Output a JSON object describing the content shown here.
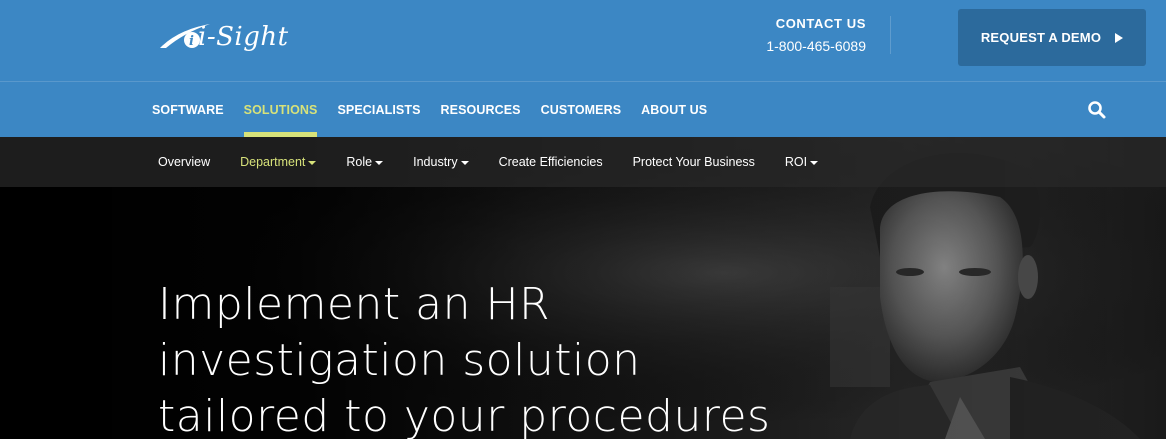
{
  "brand": {
    "logo_text": "i-Sight",
    "logo_icon": "eye-swoosh-icon"
  },
  "contact": {
    "label": "CONTACT US",
    "phone": "1-800-465-6089"
  },
  "demo_button": {
    "label": "REQUEST A DEMO",
    "icon": "play-triangle-icon"
  },
  "main_nav": {
    "items": [
      {
        "label": "SOFTWARE"
      },
      {
        "label": "SOLUTIONS"
      },
      {
        "label": "SPECIALISTS"
      },
      {
        "label": "RESOURCES"
      },
      {
        "label": "CUSTOMERS"
      },
      {
        "label": "ABOUT US"
      }
    ],
    "active": "SOLUTIONS",
    "search_icon": "search-icon"
  },
  "sub_nav": {
    "items": [
      {
        "label": "Overview"
      },
      {
        "label": "Department"
      },
      {
        "label": "Role"
      },
      {
        "label": "Industry"
      },
      {
        "label": "Create Efficiencies"
      },
      {
        "label": "Protect Your Business"
      },
      {
        "label": "ROI"
      }
    ],
    "active": "Department"
  },
  "hero": {
    "headline_lines": [
      "Implement an HR",
      "investigation solution",
      "tailored to your procedures"
    ]
  },
  "colors": {
    "header_blue": "#3c87c4",
    "button_blue": "#2c6a9c",
    "accent_lime": "#d7e27a"
  }
}
